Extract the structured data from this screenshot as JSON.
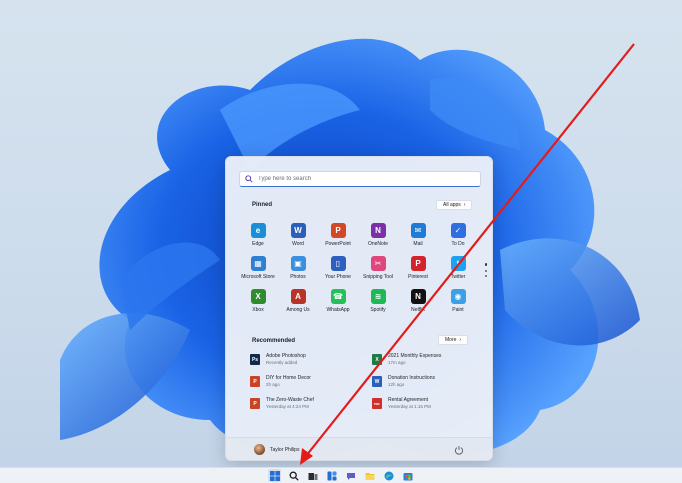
{
  "search": {
    "placeholder": "Type here to search"
  },
  "pinned": {
    "title": "Pinned",
    "all_apps_label": "All apps",
    "apps": [
      {
        "label": "Edge",
        "icon": "edge-icon",
        "color": "#1a8fd8"
      },
      {
        "label": "Word",
        "icon": "word-icon",
        "color": "#2b5fb8"
      },
      {
        "label": "PowerPoint",
        "icon": "powerpoint-icon",
        "color": "#d24726"
      },
      {
        "label": "OneNote",
        "icon": "onenote-icon",
        "color": "#7b2fa8"
      },
      {
        "label": "Mail",
        "icon": "mail-icon",
        "color": "#1f7bd3"
      },
      {
        "label": "To Do",
        "icon": "todo-icon",
        "color": "#2f6fe0"
      },
      {
        "label": "Microsoft Store",
        "icon": "store-icon",
        "color": "#2d7fd4"
      },
      {
        "label": "Photos",
        "icon": "photos-icon",
        "color": "#3a8fe0"
      },
      {
        "label": "Your Phone",
        "icon": "phone-icon",
        "color": "#2e5fbf"
      },
      {
        "label": "Snipping Tool",
        "icon": "snipping-tool-icon",
        "color": "#e0457b"
      },
      {
        "label": "Pinterest",
        "icon": "pinterest-icon",
        "color": "#d5232b"
      },
      {
        "label": "Twitter",
        "icon": "twitter-icon",
        "color": "#1da1f2"
      },
      {
        "label": "Xbox",
        "icon": "xbox-icon",
        "color": "#2e8b2e"
      },
      {
        "label": "Among Us",
        "icon": "among-us-icon",
        "color": "#b8332a"
      },
      {
        "label": "WhatsApp",
        "icon": "whatsapp-icon",
        "color": "#25c05a"
      },
      {
        "label": "Spotify",
        "icon": "spotify-icon",
        "color": "#1db954"
      },
      {
        "label": "Netflix",
        "icon": "netflix-icon",
        "color": "#111111"
      },
      {
        "label": "Paint",
        "icon": "paint-icon",
        "color": "#3aa0e8"
      }
    ]
  },
  "recommended": {
    "title": "Recommended",
    "more_label": "More",
    "items": [
      {
        "title": "Adobe Photoshop",
        "subtitle": "Recently added",
        "icon": "photoshop-icon",
        "color": "#0f2a4a",
        "glyph": "Ps"
      },
      {
        "title": "2021 Monthly Expenses",
        "subtitle": "17m ago",
        "icon": "excel-icon",
        "color": "#1f7a44",
        "glyph": "X"
      },
      {
        "title": "DIY for Home Decor",
        "subtitle": "2h ago",
        "icon": "powerpoint-file-icon",
        "color": "#c94424",
        "glyph": "P"
      },
      {
        "title": "Donation Instructions",
        "subtitle": "12h ago",
        "icon": "word-file-icon",
        "color": "#2b5fb8",
        "glyph": "W"
      },
      {
        "title": "The Zero-Waste Chef",
        "subtitle": "Yesterday at 4:24 PM",
        "icon": "powerpoint-file-icon",
        "color": "#c94424",
        "glyph": "P"
      },
      {
        "title": "Rental Agreement",
        "subtitle": "Yesterday at 1:15 PM",
        "icon": "pdf-file-icon",
        "color": "#d0302a",
        "glyph": "PDF"
      }
    ]
  },
  "user": {
    "name": "Taylor Philips"
  },
  "taskbar": {
    "items": [
      {
        "name": "start-icon",
        "active": true
      },
      {
        "name": "search-icon"
      },
      {
        "name": "task-view-icon"
      },
      {
        "name": "widgets-icon"
      },
      {
        "name": "chat-icon"
      },
      {
        "name": "file-explorer-icon"
      },
      {
        "name": "edge-icon"
      },
      {
        "name": "store-icon"
      }
    ]
  },
  "colors": {
    "accent": "#1f6fd6",
    "annotation": "#e31b1b"
  }
}
